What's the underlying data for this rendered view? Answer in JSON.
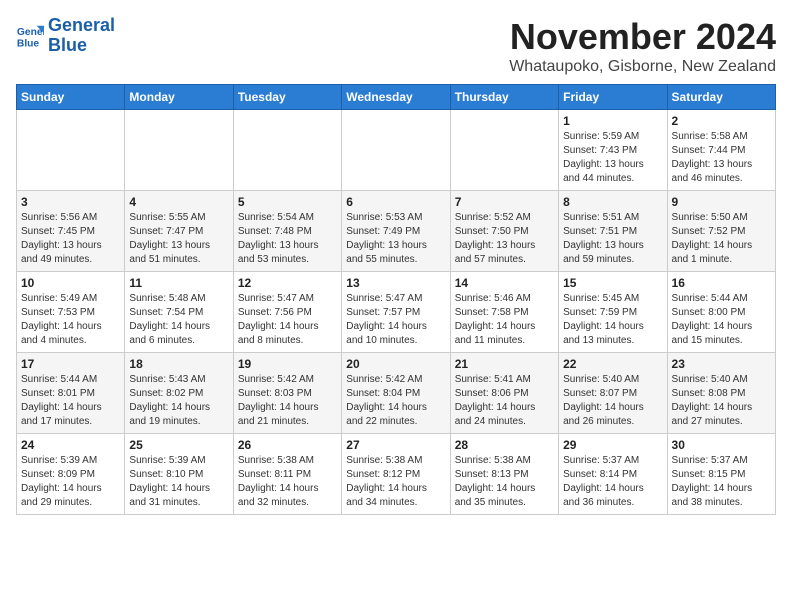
{
  "logo": {
    "line1": "General",
    "line2": "Blue"
  },
  "header": {
    "title": "November 2024",
    "subtitle": "Whataupoko, Gisborne, New Zealand"
  },
  "weekdays": [
    "Sunday",
    "Monday",
    "Tuesday",
    "Wednesday",
    "Thursday",
    "Friday",
    "Saturday"
  ],
  "weeks": [
    [
      {
        "day": "",
        "info": ""
      },
      {
        "day": "",
        "info": ""
      },
      {
        "day": "",
        "info": ""
      },
      {
        "day": "",
        "info": ""
      },
      {
        "day": "",
        "info": ""
      },
      {
        "day": "1",
        "info": "Sunrise: 5:59 AM\nSunset: 7:43 PM\nDaylight: 13 hours\nand 44 minutes."
      },
      {
        "day": "2",
        "info": "Sunrise: 5:58 AM\nSunset: 7:44 PM\nDaylight: 13 hours\nand 46 minutes."
      }
    ],
    [
      {
        "day": "3",
        "info": "Sunrise: 5:56 AM\nSunset: 7:45 PM\nDaylight: 13 hours\nand 49 minutes."
      },
      {
        "day": "4",
        "info": "Sunrise: 5:55 AM\nSunset: 7:47 PM\nDaylight: 13 hours\nand 51 minutes."
      },
      {
        "day": "5",
        "info": "Sunrise: 5:54 AM\nSunset: 7:48 PM\nDaylight: 13 hours\nand 53 minutes."
      },
      {
        "day": "6",
        "info": "Sunrise: 5:53 AM\nSunset: 7:49 PM\nDaylight: 13 hours\nand 55 minutes."
      },
      {
        "day": "7",
        "info": "Sunrise: 5:52 AM\nSunset: 7:50 PM\nDaylight: 13 hours\nand 57 minutes."
      },
      {
        "day": "8",
        "info": "Sunrise: 5:51 AM\nSunset: 7:51 PM\nDaylight: 13 hours\nand 59 minutes."
      },
      {
        "day": "9",
        "info": "Sunrise: 5:50 AM\nSunset: 7:52 PM\nDaylight: 14 hours\nand 1 minute."
      }
    ],
    [
      {
        "day": "10",
        "info": "Sunrise: 5:49 AM\nSunset: 7:53 PM\nDaylight: 14 hours\nand 4 minutes."
      },
      {
        "day": "11",
        "info": "Sunrise: 5:48 AM\nSunset: 7:54 PM\nDaylight: 14 hours\nand 6 minutes."
      },
      {
        "day": "12",
        "info": "Sunrise: 5:47 AM\nSunset: 7:56 PM\nDaylight: 14 hours\nand 8 minutes."
      },
      {
        "day": "13",
        "info": "Sunrise: 5:47 AM\nSunset: 7:57 PM\nDaylight: 14 hours\nand 10 minutes."
      },
      {
        "day": "14",
        "info": "Sunrise: 5:46 AM\nSunset: 7:58 PM\nDaylight: 14 hours\nand 11 minutes."
      },
      {
        "day": "15",
        "info": "Sunrise: 5:45 AM\nSunset: 7:59 PM\nDaylight: 14 hours\nand 13 minutes."
      },
      {
        "day": "16",
        "info": "Sunrise: 5:44 AM\nSunset: 8:00 PM\nDaylight: 14 hours\nand 15 minutes."
      }
    ],
    [
      {
        "day": "17",
        "info": "Sunrise: 5:44 AM\nSunset: 8:01 PM\nDaylight: 14 hours\nand 17 minutes."
      },
      {
        "day": "18",
        "info": "Sunrise: 5:43 AM\nSunset: 8:02 PM\nDaylight: 14 hours\nand 19 minutes."
      },
      {
        "day": "19",
        "info": "Sunrise: 5:42 AM\nSunset: 8:03 PM\nDaylight: 14 hours\nand 21 minutes."
      },
      {
        "day": "20",
        "info": "Sunrise: 5:42 AM\nSunset: 8:04 PM\nDaylight: 14 hours\nand 22 minutes."
      },
      {
        "day": "21",
        "info": "Sunrise: 5:41 AM\nSunset: 8:06 PM\nDaylight: 14 hours\nand 24 minutes."
      },
      {
        "day": "22",
        "info": "Sunrise: 5:40 AM\nSunset: 8:07 PM\nDaylight: 14 hours\nand 26 minutes."
      },
      {
        "day": "23",
        "info": "Sunrise: 5:40 AM\nSunset: 8:08 PM\nDaylight: 14 hours\nand 27 minutes."
      }
    ],
    [
      {
        "day": "24",
        "info": "Sunrise: 5:39 AM\nSunset: 8:09 PM\nDaylight: 14 hours\nand 29 minutes."
      },
      {
        "day": "25",
        "info": "Sunrise: 5:39 AM\nSunset: 8:10 PM\nDaylight: 14 hours\nand 31 minutes."
      },
      {
        "day": "26",
        "info": "Sunrise: 5:38 AM\nSunset: 8:11 PM\nDaylight: 14 hours\nand 32 minutes."
      },
      {
        "day": "27",
        "info": "Sunrise: 5:38 AM\nSunset: 8:12 PM\nDaylight: 14 hours\nand 34 minutes."
      },
      {
        "day": "28",
        "info": "Sunrise: 5:38 AM\nSunset: 8:13 PM\nDaylight: 14 hours\nand 35 minutes."
      },
      {
        "day": "29",
        "info": "Sunrise: 5:37 AM\nSunset: 8:14 PM\nDaylight: 14 hours\nand 36 minutes."
      },
      {
        "day": "30",
        "info": "Sunrise: 5:37 AM\nSunset: 8:15 PM\nDaylight: 14 hours\nand 38 minutes."
      }
    ]
  ]
}
